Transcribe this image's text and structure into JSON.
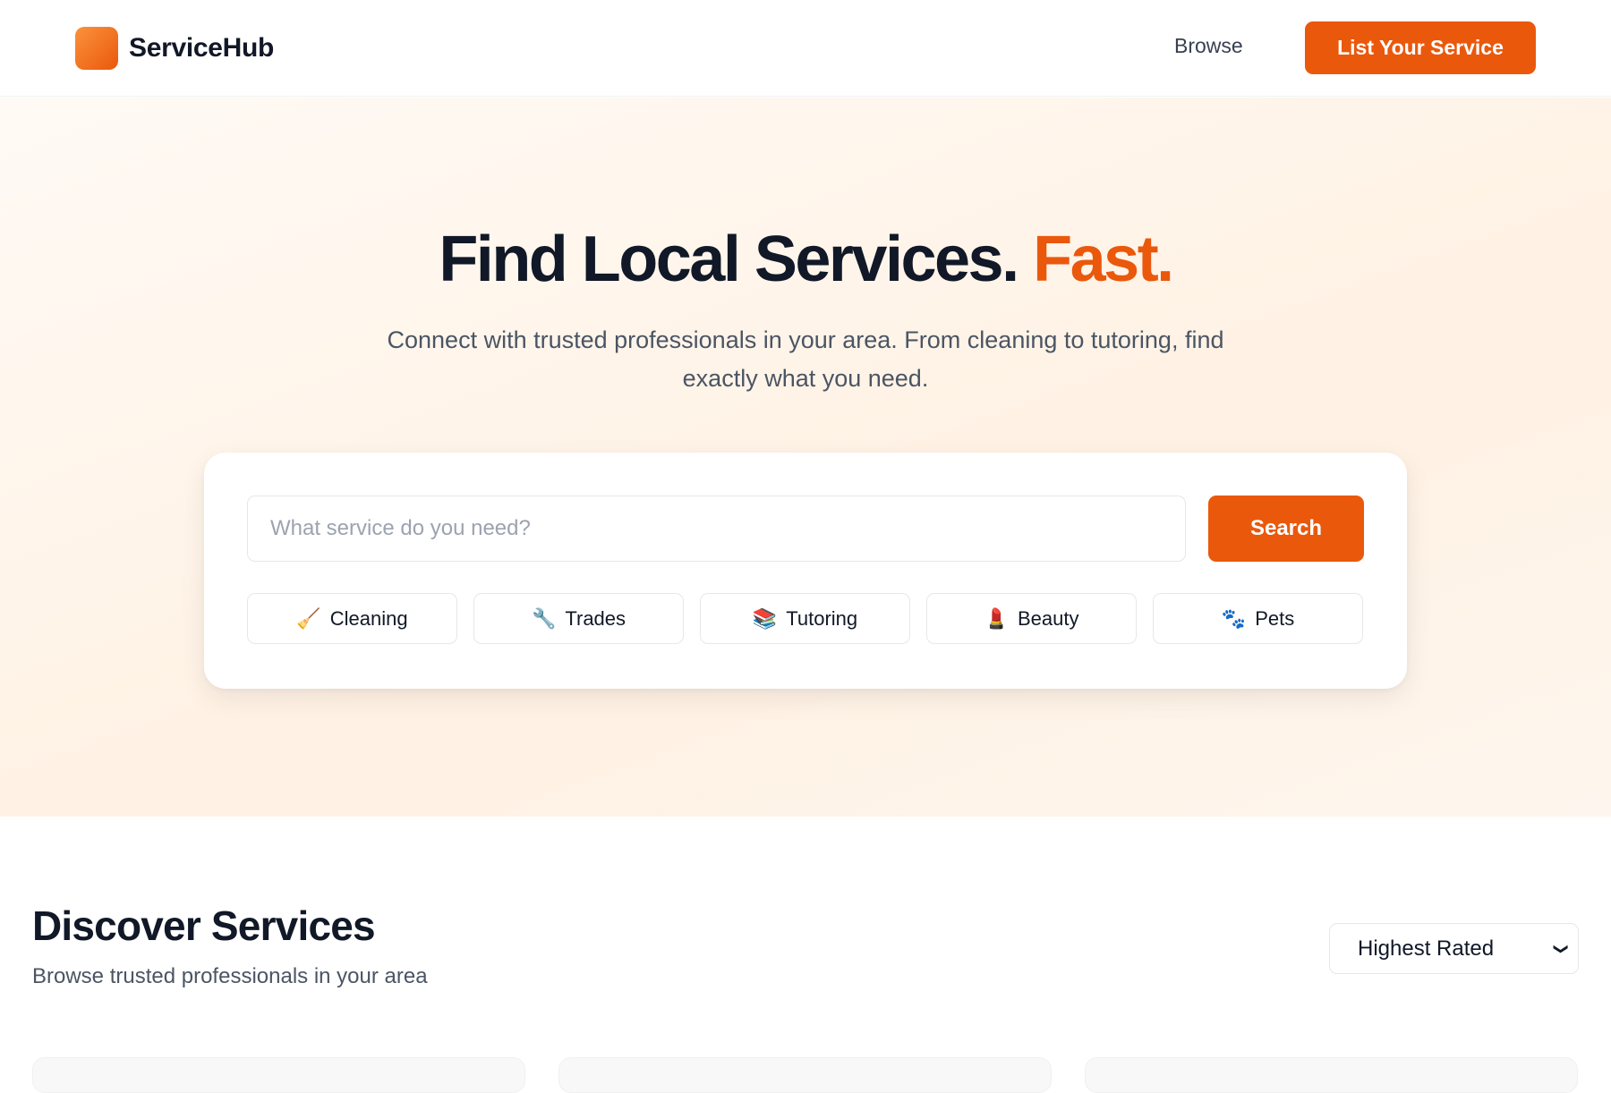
{
  "header": {
    "brand_name": "ServiceHub",
    "nav_browse": "Browse",
    "cta_label": "List Your Service"
  },
  "hero": {
    "title_main": "Find Local Services.",
    "title_accent": "Fast.",
    "subtitle": "Connect with trusted professionals in your area. From cleaning to tutoring, find exactly what you need.",
    "search": {
      "placeholder": "What service do you need?",
      "value": "",
      "button_label": "Search"
    },
    "categories": [
      {
        "icon": "🧹",
        "icon_name": "broom-icon",
        "label": "Cleaning"
      },
      {
        "icon": "🔧",
        "icon_name": "wrench-icon",
        "label": "Trades"
      },
      {
        "icon": "📚",
        "icon_name": "books-icon",
        "label": "Tutoring"
      },
      {
        "icon": "💄",
        "icon_name": "lipstick-icon",
        "label": "Beauty"
      },
      {
        "icon": "🐾",
        "icon_name": "paw-prints-icon",
        "label": "Pets"
      }
    ]
  },
  "discover": {
    "title": "Discover Services",
    "subtitle": "Browse trusted professionals in your area",
    "sort": {
      "selected": "Highest Rated"
    }
  },
  "colors": {
    "accent": "#ea580c",
    "text_primary": "#111827",
    "text_secondary": "#4b5563"
  }
}
